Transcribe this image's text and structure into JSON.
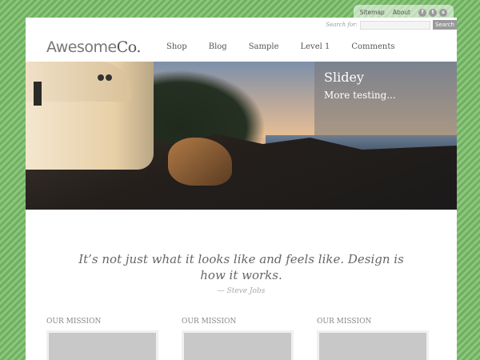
{
  "topbar": {
    "links": [
      "Sitemap",
      "About"
    ],
    "social": [
      "f",
      "t",
      "s"
    ]
  },
  "search": {
    "label": "Search for:",
    "button": "Search",
    "value": ""
  },
  "logo": {
    "main": "Awesome",
    "suffix": "Co."
  },
  "nav": {
    "items": [
      "Shop",
      "Blog",
      "Sample",
      "Level 1",
      "Comments"
    ]
  },
  "slider": {
    "title": "Slidey",
    "subtitle": "More testing..."
  },
  "quote": {
    "text": "It’s not just what it looks like and feels like. Design is how it works.",
    "author": "— Steve Jobs"
  },
  "columns": [
    {
      "heading": "OUR MISSION"
    },
    {
      "heading": "OUR MISSION"
    },
    {
      "heading": "OUR MISSION"
    }
  ],
  "colors": {
    "background": "#78b86a",
    "accent": "#999999"
  }
}
